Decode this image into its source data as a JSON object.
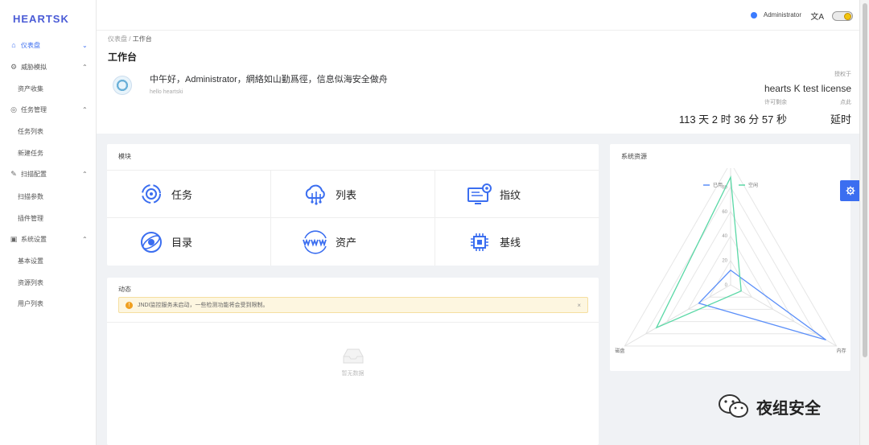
{
  "app": {
    "logo": "HEARTSK"
  },
  "sidebar": {
    "items": [
      {
        "label": "仪表盘",
        "icon": "home-icon",
        "chevron": "⌄",
        "active": true
      },
      {
        "label": "威胁模拟",
        "icon": "gear-icon",
        "chevron": "⌃"
      },
      {
        "label": "任务管理",
        "icon": "target-icon",
        "chevron": "⌃"
      },
      {
        "label": "扫描配置",
        "icon": "edit-icon",
        "chevron": "⌃"
      },
      {
        "label": "系统设置",
        "icon": "panel-icon",
        "chevron": "⌃"
      }
    ],
    "subitems": {
      "threat": [
        "资产收集"
      ],
      "task": [
        "任务列表",
        "新建任务"
      ],
      "scan": [
        "扫描参数",
        "插件管理"
      ],
      "system": [
        "基本设置",
        "资源列表",
        "用户列表"
      ]
    }
  },
  "topbar": {
    "user": "Administrator",
    "lang_icon": "文A"
  },
  "header": {
    "breadcrumb": [
      "仪表盘",
      "工作台"
    ],
    "breadcrumb_sep": "/",
    "title": "工作台",
    "greeting": "中午好，Administrator，網絡如山勤爲徑，信息似海安全做舟",
    "hello": "hello heartski",
    "license_caption": "授权于",
    "license_name": "hearts K test license",
    "stats": [
      {
        "caption": "许可剩余",
        "value": "113 天 2 时 36 分 57 秒"
      },
      {
        "caption": "点此",
        "value": "延时"
      }
    ]
  },
  "modules": {
    "title": "模块",
    "items": [
      {
        "label": "任务",
        "icon": "target-icon"
      },
      {
        "label": "列表",
        "icon": "cloud-network-icon"
      },
      {
        "label": "指纹",
        "icon": "monitor-gear-icon"
      },
      {
        "label": "目录",
        "icon": "globe-icon"
      },
      {
        "label": "资产",
        "icon": "www-icon"
      },
      {
        "label": "基线",
        "icon": "chip-icon"
      }
    ]
  },
  "dynamic": {
    "title": "动态",
    "alert": "JNDI监控服务未启动，一些检测功能将会受到限制。",
    "alert_close": "×",
    "empty": "暂无数据"
  },
  "sysres": {
    "title": "系统资源",
    "legend": [
      "已用",
      "空闲"
    ],
    "colors": {
      "used": "#5b8ff9",
      "free": "#5ad8a6"
    }
  },
  "chart_data": {
    "type": "radar",
    "indicators": [
      "CPU",
      "内存",
      "磁盘"
    ],
    "ticks": [
      0,
      20,
      40,
      60,
      80
    ],
    "max": 100,
    "series": [
      {
        "name": "已用",
        "values": [
          12,
          90,
          30
        ]
      },
      {
        "name": "空闲",
        "values": [
          88,
          10,
          70
        ]
      }
    ]
  },
  "watermark": {
    "label": "夜组安全"
  }
}
